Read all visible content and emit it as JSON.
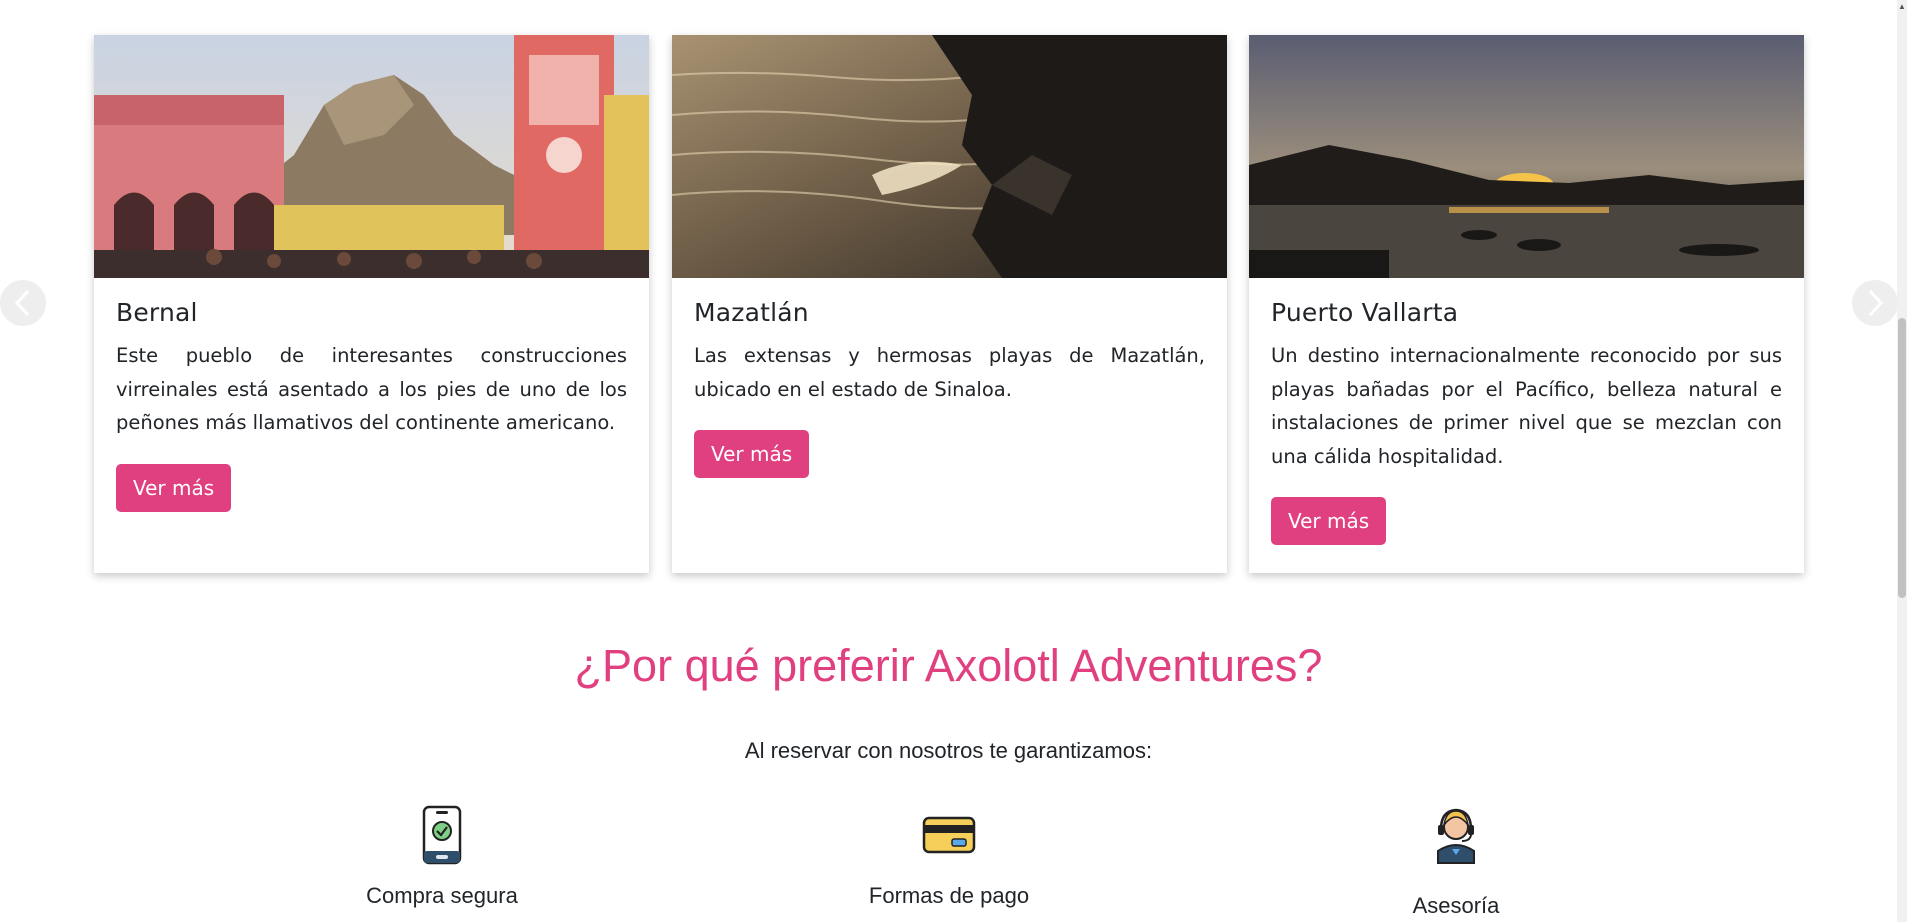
{
  "carousel": {
    "prev_icon": "chevron-left-icon",
    "next_icon": "chevron-right-icon",
    "cards": [
      {
        "title": "Bernal",
        "text": "Este pueblo de interesantes construcciones virreinales está asentado a los pies de uno de los peñones más llamativos del continente americano.",
        "button": "Ver más"
      },
      {
        "title": "Mazatlán",
        "text": "Las extensas y hermosas playas de Mazatlán, ubicado en el estado de Sinaloa.",
        "button": "Ver más"
      },
      {
        "title": "Puerto Vallarta",
        "text": "Un destino internacionalmente reconocido por sus playas bañadas por el Pacífico, belleza natural e instalaciones de primer nivel que se mezclan con una cálida hospitalidad.",
        "button": "Ver más"
      }
    ]
  },
  "why": {
    "title": "¿Por qué preferir Axolotl Adventures?",
    "subtitle": "Al reservar con nosotros te garantizamos:",
    "features": [
      {
        "label": "Compra segura",
        "icon": "secure-phone-icon"
      },
      {
        "label": "Formas de pago",
        "icon": "credit-card-icon"
      },
      {
        "label": "Asesoría",
        "icon": "support-agent-icon"
      }
    ]
  },
  "colors": {
    "accent": "#e0407f",
    "text": "#212529"
  }
}
